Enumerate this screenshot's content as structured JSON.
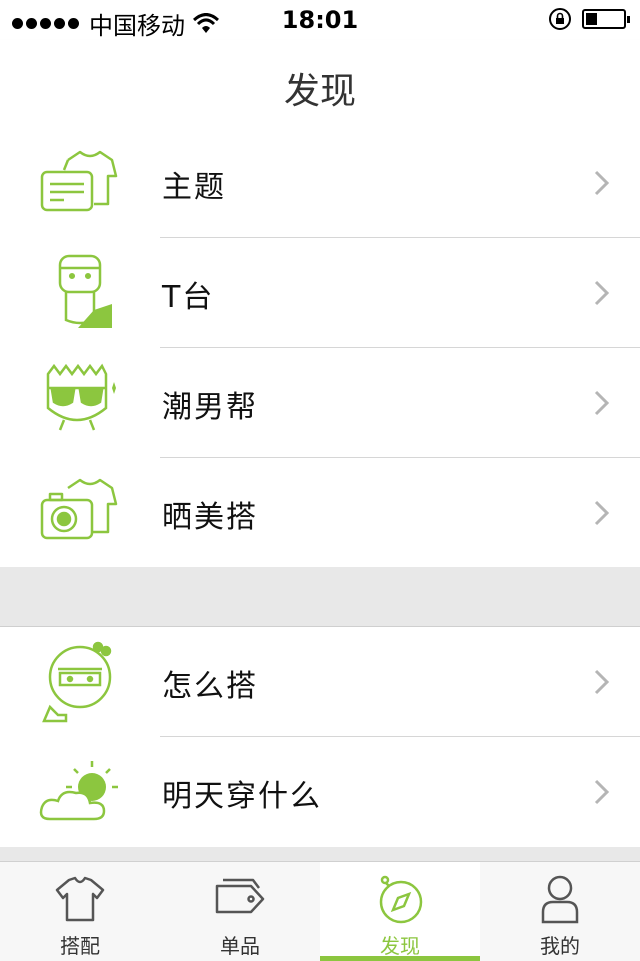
{
  "status_bar": {
    "carrier": "中国移动",
    "time": "18:01",
    "battery_level": 0.3
  },
  "nav": {
    "title": "发现"
  },
  "section1": [
    {
      "label": "主题",
      "icon": "tshirt-message-icon"
    },
    {
      "label": "T台",
      "icon": "runway-girl-icon"
    },
    {
      "label": "潮男帮",
      "icon": "cool-guy-sunglasses-icon"
    },
    {
      "label": "晒美搭",
      "icon": "camera-tshirt-icon"
    }
  ],
  "section2": [
    {
      "label": "怎么搭",
      "icon": "girl-face-heel-icon"
    },
    {
      "label": "明天穿什么",
      "icon": "weather-sun-cloud-icon"
    }
  ],
  "tabs": [
    {
      "label": "搭配",
      "icon": "tshirt-icon",
      "active": false
    },
    {
      "label": "单品",
      "icon": "tag-icon",
      "active": false
    },
    {
      "label": "发现",
      "icon": "compass-icon",
      "active": true
    },
    {
      "label": "我的",
      "icon": "person-icon",
      "active": false
    }
  ],
  "colors": {
    "accent": "#8cc63f",
    "separator": "#d6d6d6",
    "section_gap": "#e8e8e8"
  }
}
